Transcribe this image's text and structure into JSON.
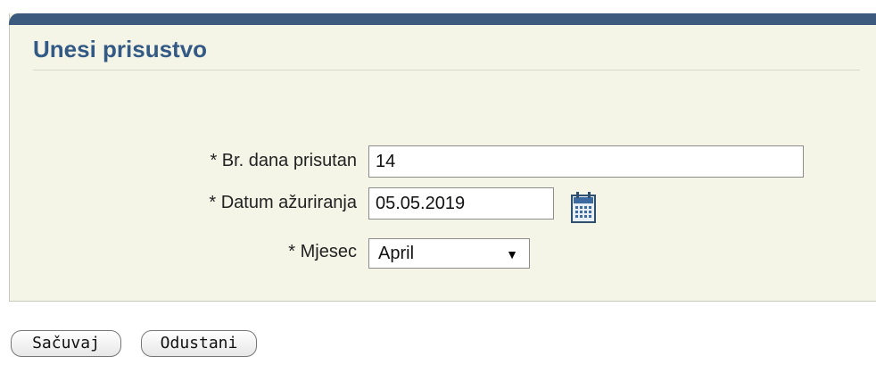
{
  "panel": {
    "title": "Unesi prisustvo"
  },
  "form": {
    "days_present": {
      "label": "* Br. dana prisutan",
      "value": "14"
    },
    "update_date": {
      "label": "* Datum ažuriranja",
      "value": "05.05.2019"
    },
    "month": {
      "label": "* Mjesec",
      "selected": "April"
    }
  },
  "actions": {
    "save_label": "Sačuvaj",
    "cancel_label": "Odustani"
  },
  "icons": {
    "calendar": "calendar-icon",
    "dropdown": "caret-down-icon"
  },
  "colors": {
    "panel_background": "#f4f4e7",
    "header_bar": "#3c5a7e",
    "title_text": "#335a85"
  }
}
